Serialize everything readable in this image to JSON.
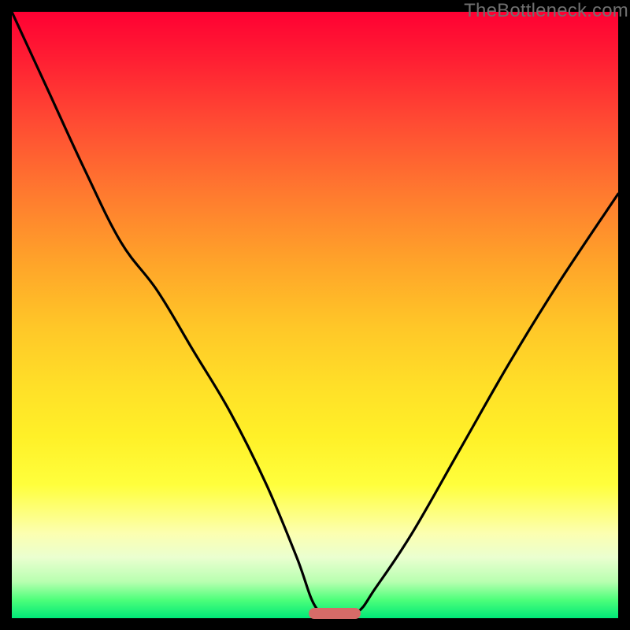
{
  "watermark": "TheBottleneck.com",
  "marker": {
    "x_pct": 49.0,
    "width_pct": 8.5,
    "color": "#d66b68"
  },
  "chart_data": {
    "type": "line",
    "title": "",
    "xlabel": "",
    "ylabel": "",
    "xlim": [
      0,
      100
    ],
    "ylim": [
      0,
      100
    ],
    "grid": false,
    "legend": false,
    "background": "red-yellow-green vertical gradient",
    "annotations": [
      "bottleneck marker pill near x≈53"
    ],
    "series": [
      {
        "name": "bottleneck-curve",
        "x": [
          0,
          6,
          12,
          18,
          24,
          30,
          36,
          42,
          47,
          50,
          53,
          57,
          60,
          66,
          74,
          82,
          90,
          100
        ],
        "values": [
          100,
          87,
          74,
          62,
          54,
          44,
          34,
          22,
          10,
          2,
          0,
          1,
          5,
          14,
          28,
          42,
          55,
          70
        ]
      }
    ]
  }
}
